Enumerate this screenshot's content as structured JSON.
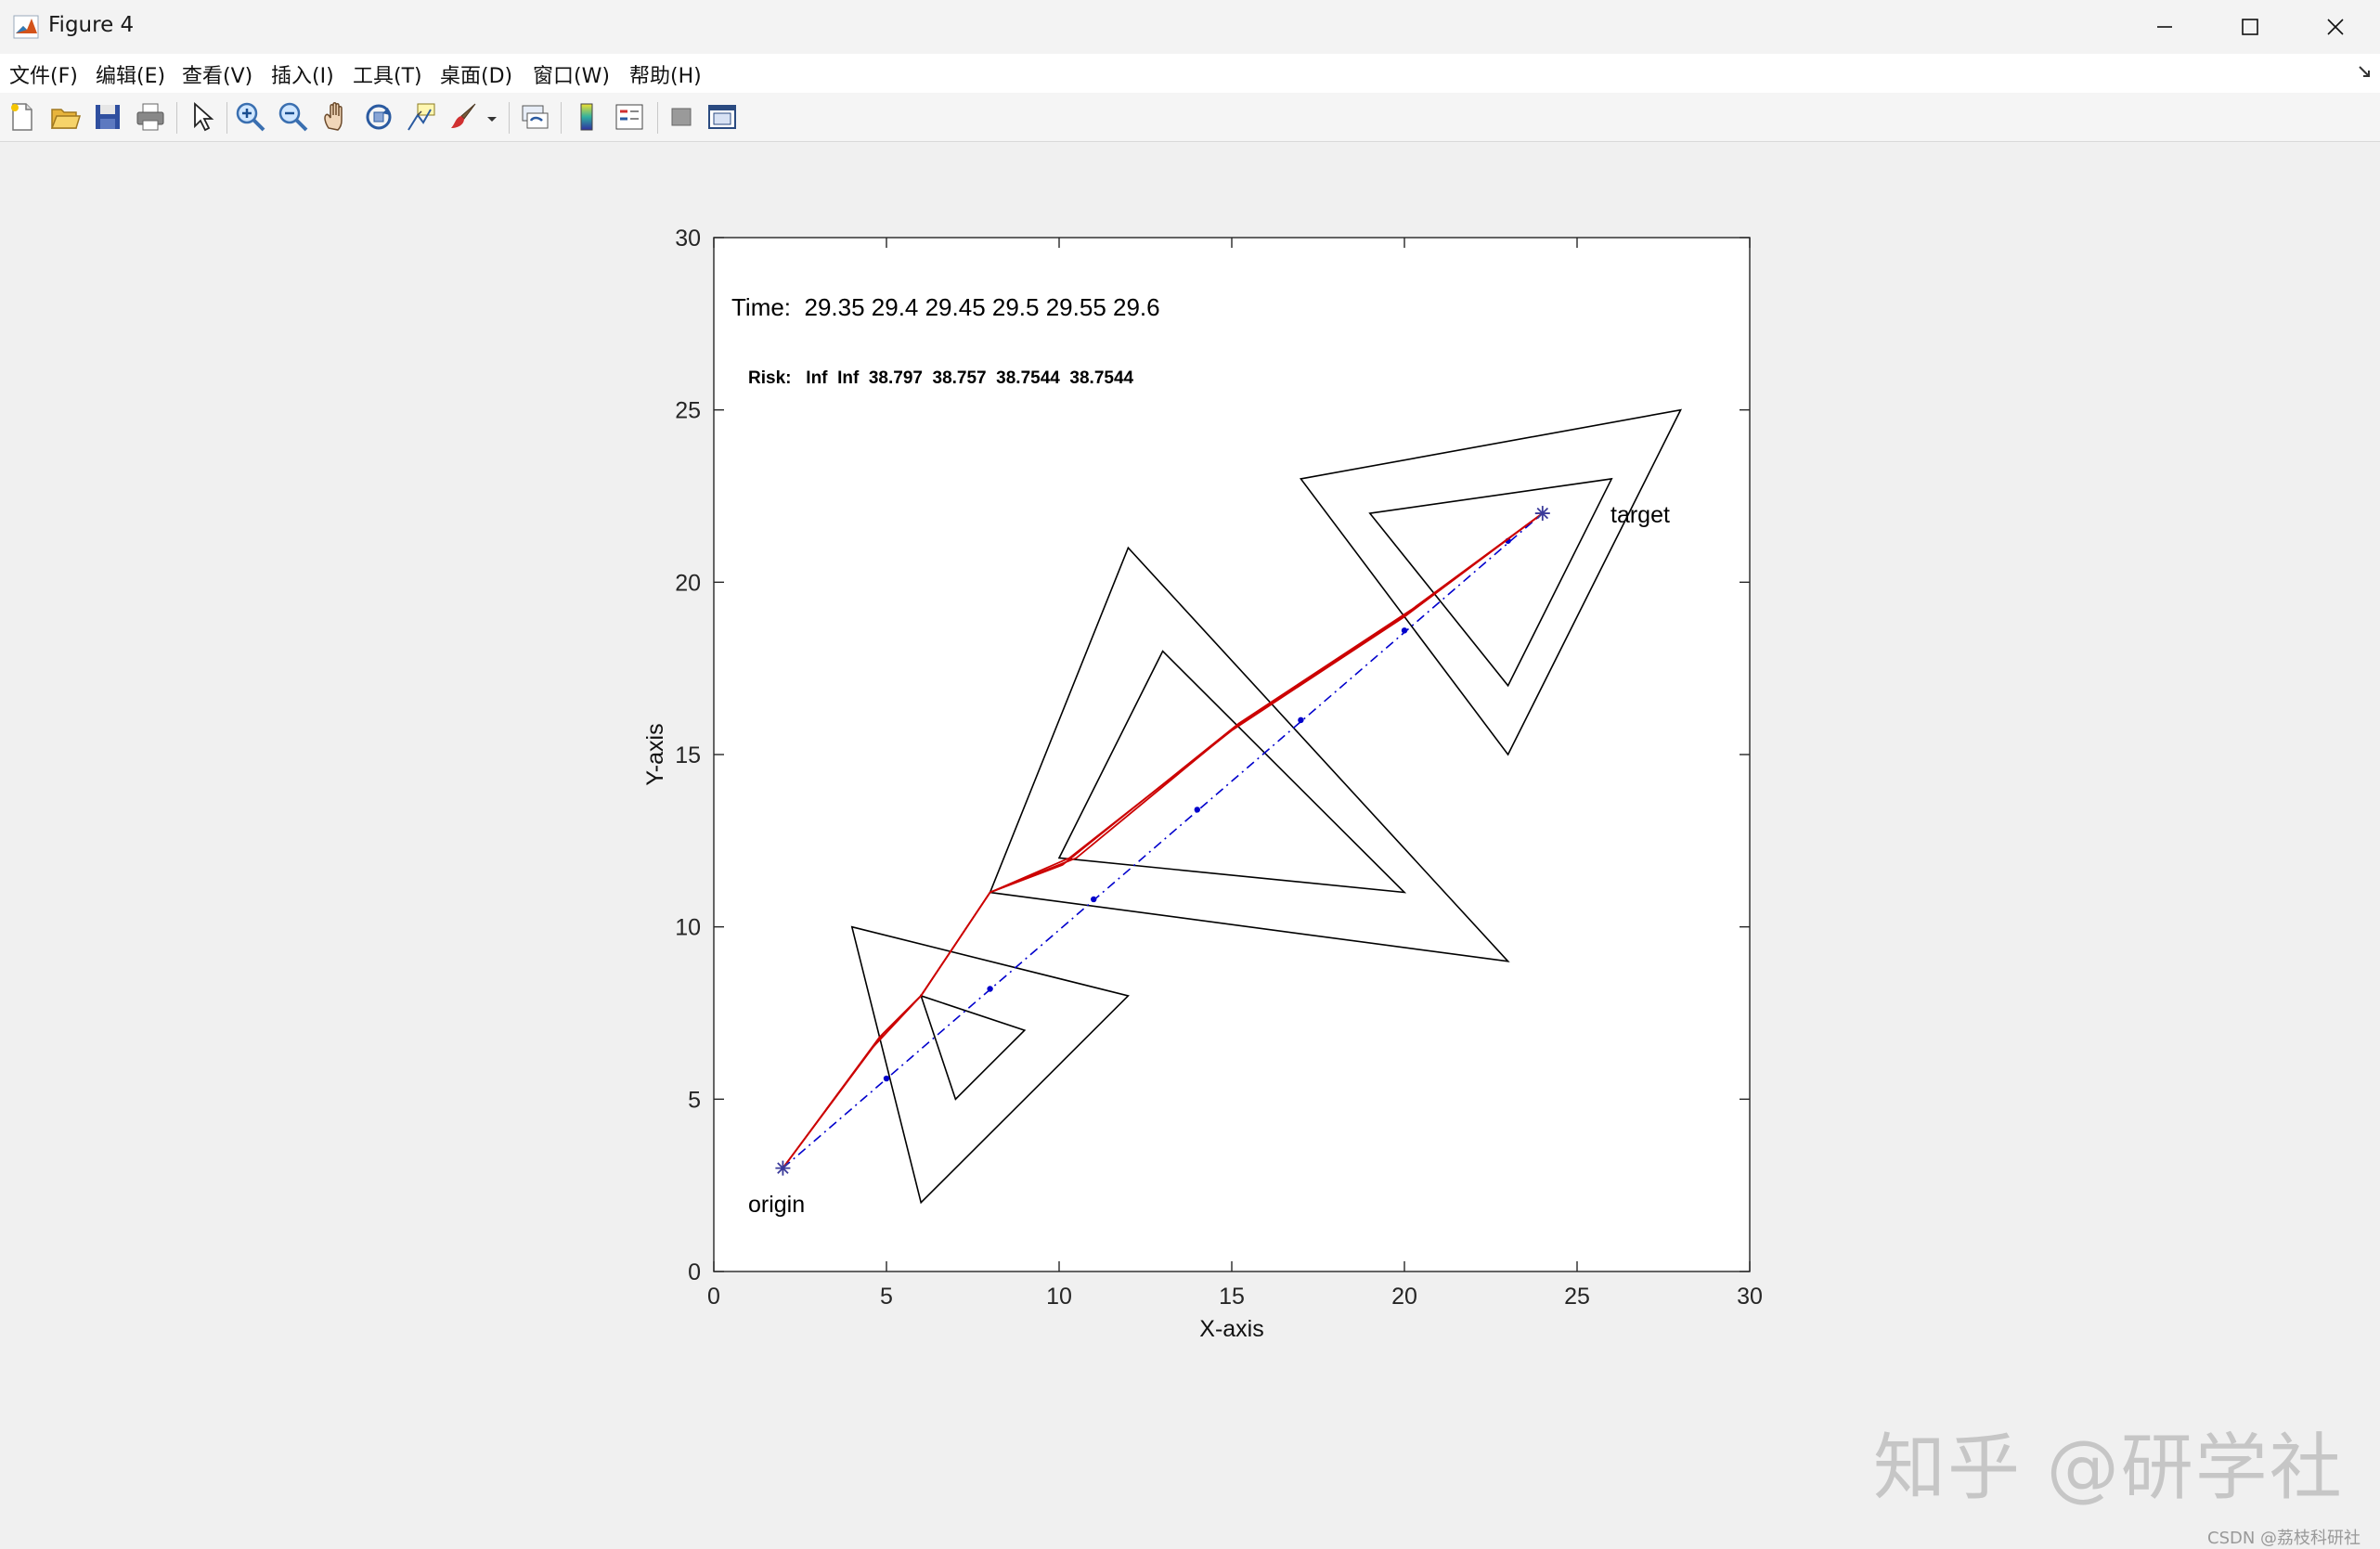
{
  "window": {
    "title": "Figure 4"
  },
  "menu": [
    "文件(F)",
    "编辑(E)",
    "查看(V)",
    "插入(I)",
    "工具(T)",
    "桌面(D)",
    "窗口(W)",
    "帮助(H)"
  ],
  "toolbar_icons": [
    "new-figure-icon",
    "open-file-icon",
    "save-icon",
    "print-icon",
    "select-arrow-icon",
    "zoom-in-icon",
    "zoom-out-icon",
    "pan-hand-icon",
    "rotate-3d-icon",
    "data-cursor-icon",
    "brush-icon",
    "brush-dropdown-icon",
    "link-plot-icon",
    "colorbar-icon",
    "legend-icon",
    "hide-plot-tools-icon",
    "show-plot-tools-icon"
  ],
  "colors": {
    "path": "#cc0000",
    "straight_line": "#0000cc",
    "obstacle": "#000000",
    "marker": "#3a3a9a"
  },
  "chart_data": {
    "type": "line",
    "xlabel": "X-axis",
    "ylabel": "Y-axis",
    "xlim": [
      0,
      30
    ],
    "ylim": [
      0,
      30
    ],
    "xticks": [
      "0",
      "5",
      "10",
      "15",
      "20",
      "25",
      "30"
    ],
    "yticks": [
      "0",
      "5",
      "10",
      "15",
      "20",
      "25",
      "30"
    ],
    "grid": false,
    "annotations": {
      "time": "Time:  29.35 29.4 29.45 29.5 29.55 29.6",
      "risk": "Risk:   Inf  Inf  38.797  38.757  38.7544  38.7544",
      "origin_label": "origin",
      "target_label": "target"
    },
    "origin": [
      2,
      3
    ],
    "target": [
      24,
      22
    ],
    "obstacles": [
      [
        [
          4,
          10
        ],
        [
          12,
          8
        ],
        [
          6,
          2
        ]
      ],
      [
        [
          6,
          8
        ],
        [
          9,
          7
        ],
        [
          7,
          5
        ]
      ],
      [
        [
          8,
          11
        ],
        [
          12,
          21
        ],
        [
          23,
          9
        ]
      ],
      [
        [
          10,
          12
        ],
        [
          13,
          18
        ],
        [
          20,
          11
        ]
      ],
      [
        [
          17,
          23
        ],
        [
          28,
          25
        ],
        [
          23,
          15
        ]
      ],
      [
        [
          19,
          22
        ],
        [
          26,
          23
        ],
        [
          23,
          17
        ]
      ]
    ],
    "paths": [
      [
        [
          2,
          3
        ],
        [
          4.8,
          6.8
        ],
        [
          6,
          8
        ],
        [
          8,
          11
        ],
        [
          10.3,
          12
        ],
        [
          15,
          15.7
        ],
        [
          20,
          19
        ],
        [
          24,
          22
        ]
      ],
      [
        [
          2,
          3
        ],
        [
          4.6,
          6.5
        ],
        [
          6,
          8
        ],
        [
          8,
          11
        ],
        [
          10.1,
          11.8
        ],
        [
          15.2,
          15.9
        ],
        [
          20.2,
          19.2
        ],
        [
          24,
          22
        ]
      ],
      [
        [
          2,
          3
        ],
        [
          4.9,
          6.9
        ],
        [
          6,
          8
        ],
        [
          8,
          11
        ],
        [
          10.5,
          12
        ],
        [
          15.1,
          15.8
        ],
        [
          20.1,
          19.1
        ],
        [
          24,
          22
        ]
      ]
    ],
    "straight_line": [
      [
        2,
        3
      ],
      [
        24,
        22
      ]
    ],
    "straight_line_markers": [
      [
        5,
        5.6
      ],
      [
        8,
        8.2
      ],
      [
        11,
        10.8
      ],
      [
        14,
        13.4
      ],
      [
        17,
        16
      ],
      [
        20,
        18.6
      ],
      [
        23,
        21.2
      ]
    ]
  }
}
